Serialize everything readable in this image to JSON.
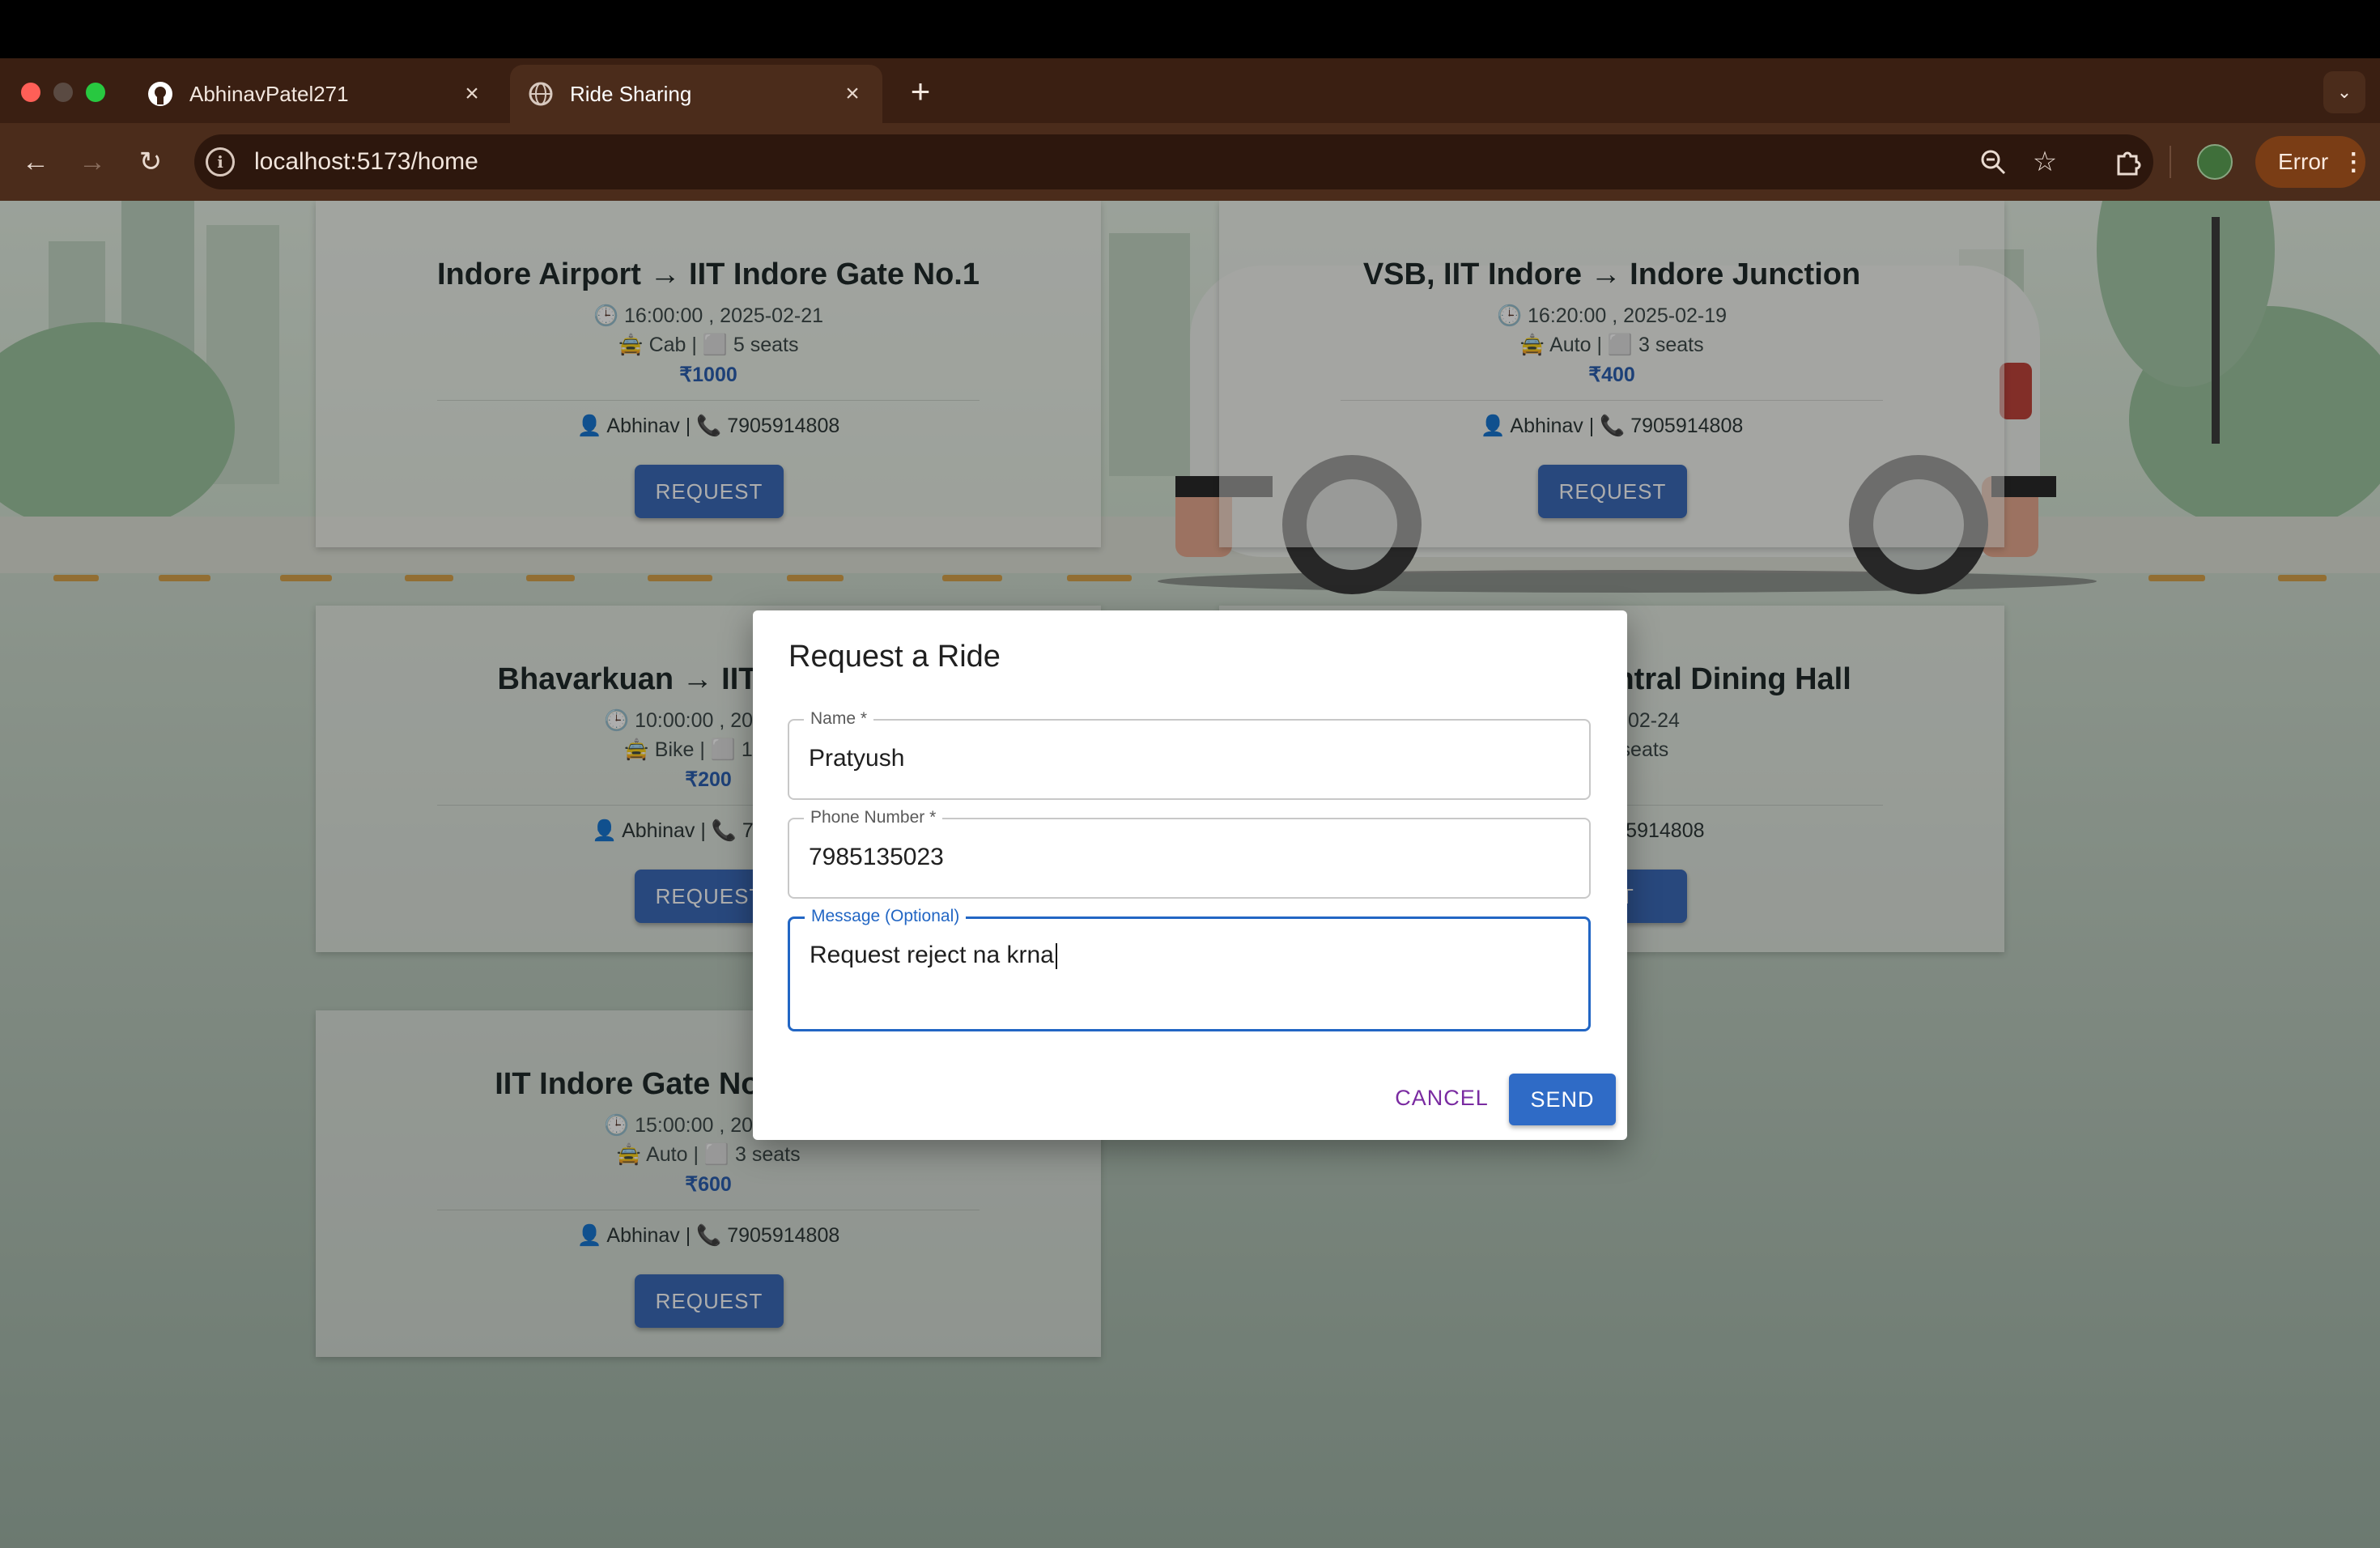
{
  "browser": {
    "tabs": [
      {
        "label": "AbhinavPatel271",
        "icon": "github-icon",
        "active": false
      },
      {
        "label": "Ride Sharing",
        "icon": "globe-icon",
        "active": true
      }
    ],
    "new_tab_symbol": "+",
    "url": "localhost:5173/home",
    "error_label": "Error"
  },
  "cards": [
    {
      "title": "Indore Airport → IIT Indore Gate No.1",
      "time": "🕒 16:00:00 , 2025-02-21",
      "vehicle": "🚖 Cab | ⬜ 5 seats",
      "price": "₹1000",
      "owner": "👤 Abhinav | 📞 7905914808",
      "button": "REQUEST"
    },
    {
      "title": "VSB, IIT Indore → Indore Junction",
      "time": "🕒 16:20:00 , 2025-02-19",
      "vehicle": "🚖 Auto | ⬜ 3 seats",
      "price": "₹400",
      "owner": "👤 Abhinav | 📞 7905914808",
      "button": "REQUEST"
    },
    {
      "title": "Bhavarkuan → IIT",
      "time": "🕒 10:00:00 , 202",
      "vehicle": "🚖 Bike | ⬜ 1 s",
      "price": "₹200",
      "owner": "👤 Abhinav | 📞 790",
      "button": "REQUEST"
    },
    {
      "title": "e Central Dining Hall",
      "time": "2025-02-24",
      "vehicle": "1 seats",
      "price": "0",
      "owner": "7905914808",
      "button": "EST"
    },
    {
      "title": "IIT Indore Gate No.1 →",
      "time": "🕒 15:00:00 , 202",
      "vehicle": "🚖 Auto | ⬜ 3 seats",
      "price": "₹600",
      "owner": "👤 Abhinav | 📞 7905914808",
      "button": "REQUEST"
    }
  ],
  "dialog": {
    "title": "Request a Ride",
    "fields": [
      {
        "label": "Name *",
        "value": "Pratyush"
      },
      {
        "label": "Phone Number *",
        "value": "7985135023"
      },
      {
        "label": "Message (Optional)",
        "value": "Request reject na krna"
      }
    ],
    "cancel_label": "CANCEL",
    "send_label": "SEND"
  }
}
